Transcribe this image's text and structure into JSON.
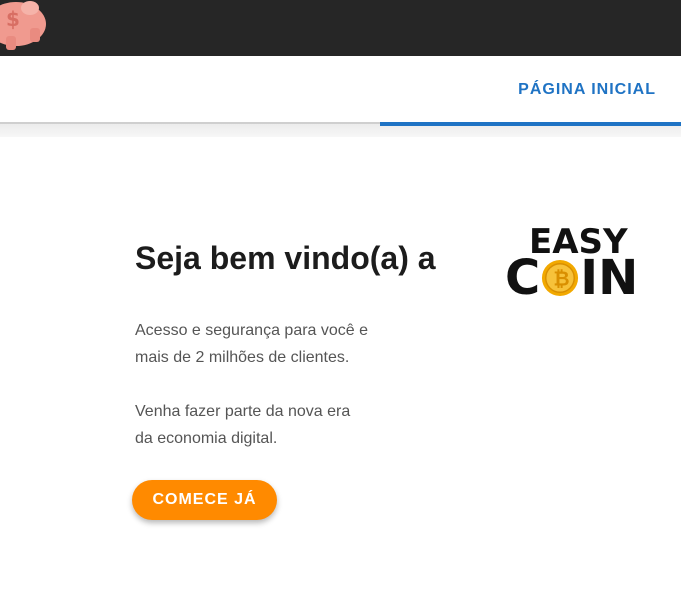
{
  "navbar": {
    "home_tab": "PÁGINA INICIAL"
  },
  "hero": {
    "title": "Seja bem vindo(a) a",
    "paragraph1_line1": "Acesso e segurança para você e",
    "paragraph1_line2": "mais de 2 milhões de clientes.",
    "paragraph2_line1": "Venha fazer parte da nova era",
    "paragraph2_line2": "da economia digital.",
    "cta_label": "COMECE JÁ"
  },
  "logo": {
    "top": "EASY",
    "bottom_left": "C",
    "bottom_right": "IN",
    "icon": "bitcoin-coin-icon"
  },
  "colors": {
    "topbar": "#262626",
    "accent": "#1f73c4",
    "cta": "#ff8a00"
  }
}
